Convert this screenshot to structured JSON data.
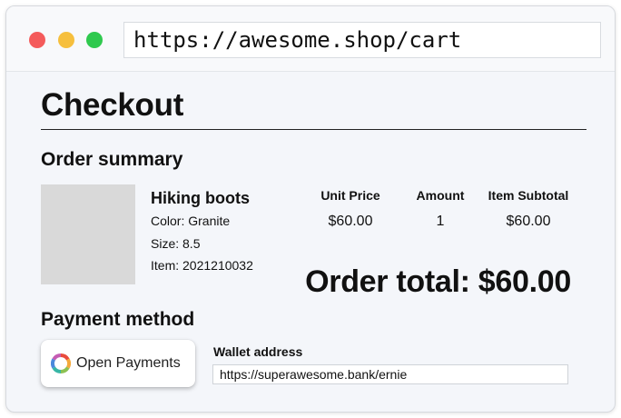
{
  "browser": {
    "url": "https://awesome.shop/cart"
  },
  "page": {
    "title": "Checkout"
  },
  "order_summary": {
    "heading": "Order summary",
    "product": {
      "name": "Hiking boots",
      "color": "Color: Granite",
      "size": "Size: 8.5",
      "item": "Item: 2021210032"
    },
    "columns": {
      "unit_price_label": "Unit Price",
      "amount_label": "Amount",
      "subtotal_label": "Item Subtotal"
    },
    "values": {
      "unit_price": "$60.00",
      "amount": "1",
      "subtotal": "$60.00"
    },
    "order_total": "Order total: $60.00"
  },
  "payment": {
    "heading": "Payment method",
    "button_label": "Open Payments",
    "button_icon": "open-payments-logo-icon",
    "wallet_label": "Wallet address",
    "wallet_value": "https://superawesome.bank/ernie"
  },
  "colors": {
    "close": "#f45b5b",
    "minimize": "#f6bf3d",
    "maximize": "#2fc94e",
    "image_placeholder": "#d9d9d9"
  }
}
